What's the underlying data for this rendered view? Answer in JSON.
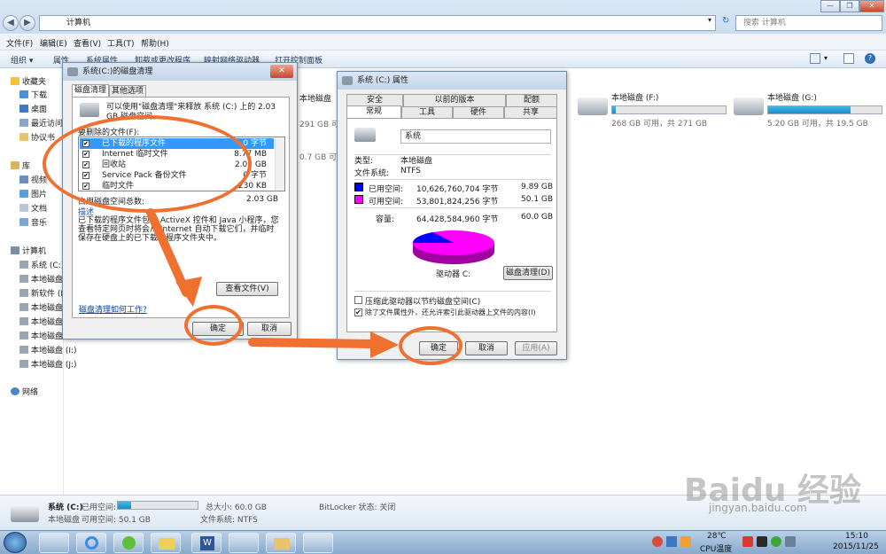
{
  "explorer": {
    "address": "计算机",
    "search_placeholder": "搜索 计算机"
  },
  "menu": [
    "文件(F)",
    "编辑(E)",
    "查看(V)",
    "工具(T)",
    "帮助(H)"
  ],
  "toolbar": [
    "组织 ▾",
    "属性",
    "系统属性",
    "卸载或更改程序",
    "映射网络驱动器",
    "打开控制面板"
  ],
  "sidebar": {
    "favorites": "收藏夹",
    "fav_items": [
      "下载",
      "桌面",
      "最近访问",
      "协议书"
    ],
    "library": "库",
    "lib_items": [
      "视频",
      "图片",
      "文档",
      "音乐"
    ],
    "computer": "计算机",
    "comp_items": [
      "系统 (C:)",
      "本地磁盘",
      "新软件 (E",
      "本地磁盘",
      "本地磁盘",
      "本地磁盘",
      "本地磁盘 (I:)",
      "本地磁盘 (J:)"
    ],
    "network": "网络"
  },
  "drives": [
    {
      "name": "本地磁盘",
      "info": "291 GB 可",
      "used_pct": 0
    },
    {
      "name": "本地磁盘 (F:)",
      "info": "268 GB 可用，共 271 GB",
      "used_pct": 3
    },
    {
      "name": "本地磁盘 (G:)",
      "info": "5.20 GB 可用，共 19.5 GB",
      "used_pct": 73
    }
  ],
  "drive_partial": "0.7 GB 可",
  "cleanup": {
    "title": "系统(C:)的磁盘清理",
    "tabs": [
      "磁盘清理",
      "其他选项"
    ],
    "intro": "可以使用\"磁盘清理\"来释放 系统 (C:) 上的 2.03 GB 磁盘空间。",
    "list_label": "要删除的文件(F):",
    "files": [
      {
        "name": "已下载的程序文件",
        "size": "0 字节"
      },
      {
        "name": "Internet 临时文件",
        "size": "8.77 MB"
      },
      {
        "name": "回收站",
        "size": "2.02 GB"
      },
      {
        "name": "Service Pack 备份文件",
        "size": "0 字节"
      },
      {
        "name": "临时文件",
        "size": "230 KB"
      }
    ],
    "total_label": "占用磁盘空间总数:",
    "total_value": "2.03 GB",
    "desc_label": "描述",
    "desc": "已下载的程序文件包括 ActiveX 控件和 Java 小程序，您查看特定网页时将会从 Internet 自动下载它们，并临时保存在硬盘上的已下载的程序文件夹中。",
    "view_files": "查看文件(V)",
    "help_link": "磁盘清理如何工作?",
    "ok": "确定",
    "cancel": "取消"
  },
  "props": {
    "title": "系统 (C:) 属性",
    "tabs_row1": [
      "安全",
      "以前的版本",
      "配额"
    ],
    "tabs_row2": [
      "常规",
      "工具",
      "硬件",
      "共享"
    ],
    "volume_name": "系统",
    "type_label": "类型:",
    "type_value": "本地磁盘",
    "fs_label": "文件系统:",
    "fs_value": "NTFS",
    "used_label": "已用空间:",
    "used_bytes": "10,626,760,704 字节",
    "used_gb": "9.89 GB",
    "free_label": "可用空间:",
    "free_bytes": "53,801,824,256 字节",
    "free_gb": "50.1 GB",
    "cap_label": "容量:",
    "cap_bytes": "64,428,584,960 字节",
    "cap_gb": "60.0 GB",
    "used_fraction": 0.165,
    "used_color": "#0000ff",
    "free_color": "#ff00ff",
    "drive_label": "驱动器 C:",
    "cleanup_btn": "磁盘清理(D)",
    "compress": "压缩此驱动器以节约磁盘空间(C)",
    "index": "除了文件属性外，还允许索引此驱动器上文件的内容(I)",
    "ok": "确定",
    "cancel": "取消",
    "apply": "应用(A)"
  },
  "status": {
    "name": "系统 (C:)",
    "used_label": "已用空间:",
    "total": "总大小: 60.0 GB",
    "bitlocker": "BitLocker 状态: 关闭",
    "type": "本地磁盘",
    "free": "可用空间: 50.1 GB",
    "fs": "文件系统: NTFS"
  },
  "taskbar": {
    "temp": "28℃",
    "cpu": "CPU温度",
    "time": "15:10",
    "date": "2015/11/25"
  },
  "watermark": "Baidu 经验",
  "watermark_url": "jingyan.baidu.com"
}
